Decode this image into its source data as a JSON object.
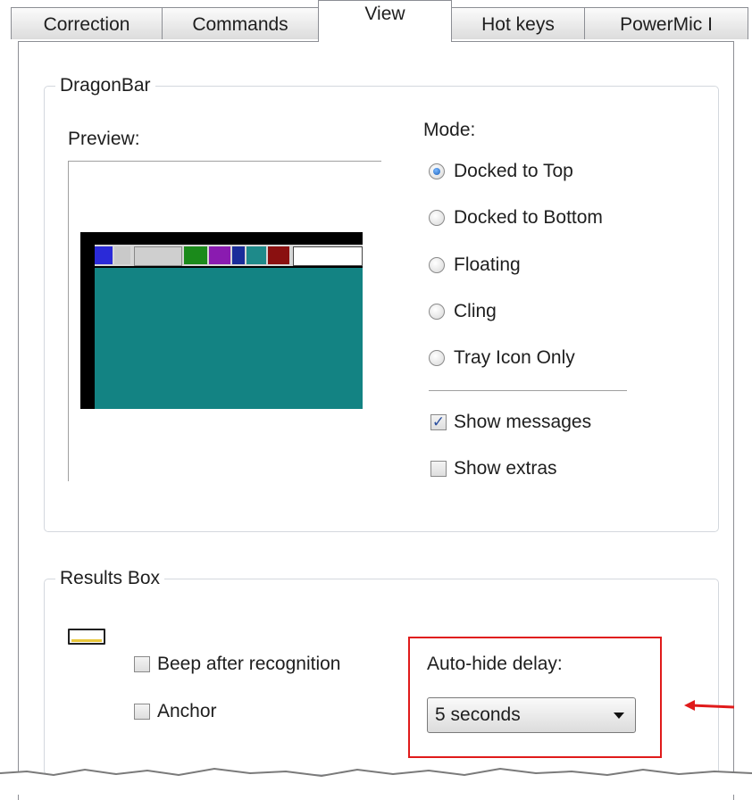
{
  "tabs": [
    {
      "label": "Correction",
      "active": false
    },
    {
      "label": "Commands",
      "active": false
    },
    {
      "label": "View",
      "active": true
    },
    {
      "label": "Hot keys",
      "active": false
    },
    {
      "label": "PowerMic I",
      "active": false
    }
  ],
  "dragonbar": {
    "group_title": "DragonBar",
    "preview_label": "Preview:",
    "mode_label": "Mode:",
    "modes": [
      {
        "label": "Docked to Top",
        "selected": true
      },
      {
        "label": "Docked to Bottom",
        "selected": false
      },
      {
        "label": "Floating",
        "selected": false
      },
      {
        "label": "Cling",
        "selected": false
      },
      {
        "label": "Tray Icon Only",
        "selected": false
      }
    ],
    "show_messages": {
      "label": "Show messages",
      "checked": true
    },
    "show_extras": {
      "label": "Show extras",
      "checked": false
    }
  },
  "results_box": {
    "group_title": "Results Box",
    "beep": {
      "label": "Beep after recognition",
      "checked": false
    },
    "anchor": {
      "label": "Anchor",
      "checked": false
    },
    "autohide_label": "Auto-hide delay:",
    "autohide_value": "5 seconds"
  },
  "colors": {
    "highlight": "#e01b1b",
    "preview_desktop": "#138383",
    "check_mark": "#2b4f9e"
  }
}
